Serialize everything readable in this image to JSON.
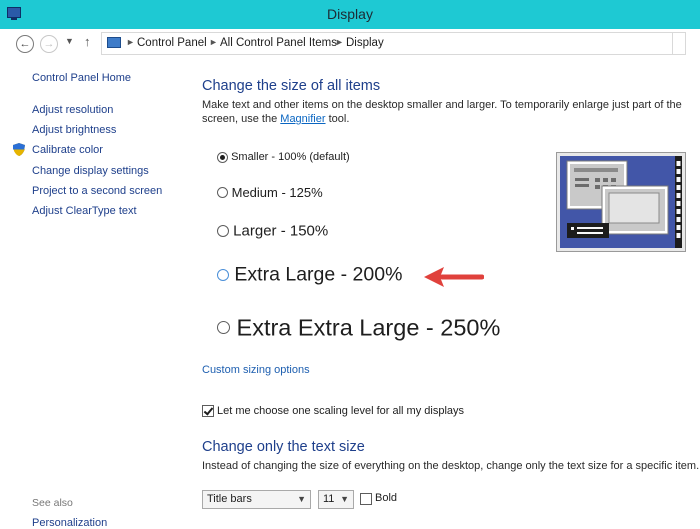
{
  "window": {
    "title": "Display"
  },
  "breadcrumb": [
    "Control Panel",
    "All Control Panel Items",
    "Display"
  ],
  "sidebar": {
    "home": "Control Panel Home",
    "items": [
      "Adjust resolution",
      "Adjust brightness",
      "Calibrate color",
      "Change display settings",
      "Project to a second screen",
      "Adjust ClearType text"
    ],
    "see_also_label": "See also",
    "see_also_items": [
      "Personalization"
    ]
  },
  "main": {
    "heading": "Change the size of all items",
    "description_pre": "Make text and other items on the desktop smaller and larger. To temporarily enlarge just part of the screen, use the ",
    "magnifier_link": "Magnifier",
    "description_post": " tool.",
    "options": [
      {
        "label": "Smaller - 100% (default)",
        "checked": true
      },
      {
        "label": "Medium - 125%",
        "checked": false
      },
      {
        "label": "Larger - 150%",
        "checked": false
      },
      {
        "label": "Extra Large - 200%",
        "checked": false
      },
      {
        "label": "Extra Extra Large - 250%",
        "checked": false
      }
    ],
    "custom_sizing": "Custom sizing options",
    "scaling_checkbox": {
      "label": "Let me choose one scaling level for all my displays",
      "checked": true
    },
    "text_heading": "Change only the text size",
    "text_description": "Instead of changing the size of everything on the desktop, change only the text size for a specific item.",
    "item_select": "Title bars",
    "size_select": "11",
    "bold_label": "Bold",
    "bold_checked": false
  },
  "colors": {
    "titlebar": "#1ec9d3",
    "link": "#1e3f8b",
    "annotation_arrow": "#e0413c",
    "preview_bg": "#4256a8"
  }
}
